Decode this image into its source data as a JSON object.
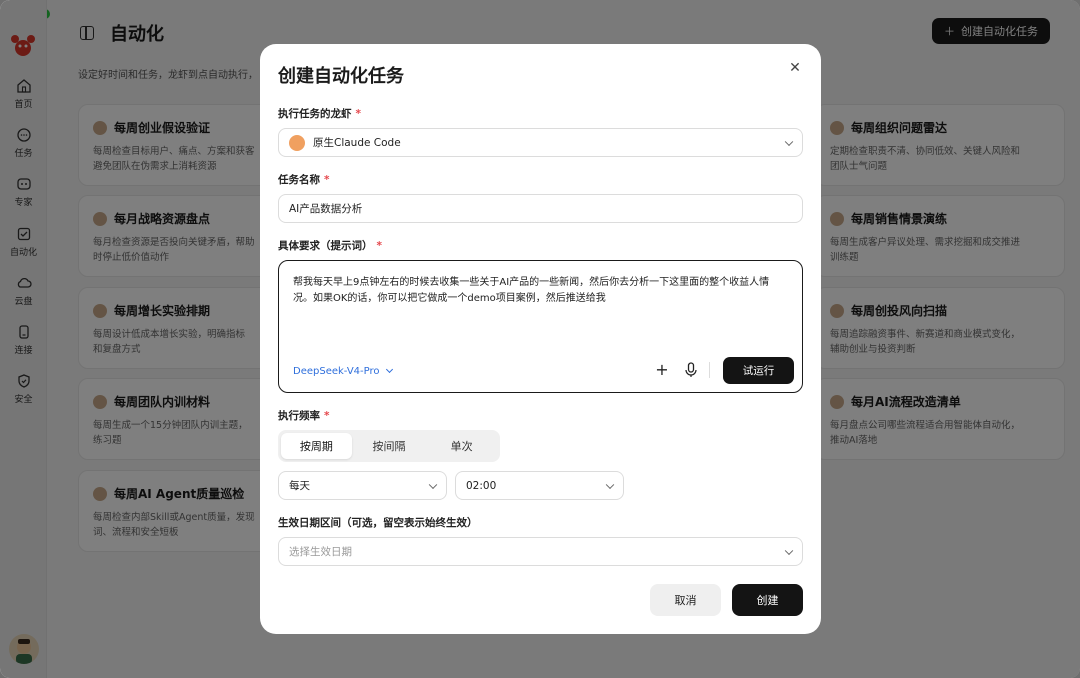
{
  "app": {
    "page_title": "自动化",
    "subtitle": "设定好时间和任务，龙虾到点自动执行，",
    "create_button": "创建自动化任务"
  },
  "sidebar": {
    "items": [
      {
        "label": "首页",
        "icon": "home-icon"
      },
      {
        "label": "任务",
        "icon": "chat-icon"
      },
      {
        "label": "专家",
        "icon": "expert-icon"
      },
      {
        "label": "自动化",
        "icon": "checklist-icon",
        "active": true
      },
      {
        "label": "云盘",
        "icon": "cloud-icon"
      },
      {
        "label": "连接",
        "icon": "device-icon"
      },
      {
        "label": "安全",
        "icon": "shield-icon"
      }
    ]
  },
  "cards_left": [
    {
      "title": "每周创业假设验证",
      "desc": "每周检查目标用户、痛点、方案和获客\n避免团队在伪需求上消耗资源"
    },
    {
      "title": "每月战略资源盘点",
      "desc": "每月检查资源是否投向关键矛盾，帮助\n时停止低价值动作"
    },
    {
      "title": "每周增长实验排期",
      "desc": "每周设计低成本增长实验，明确指标\n和复盘方式"
    },
    {
      "title": "每周团队内训材料",
      "desc": "每周生成一个15分钟团队内训主题，\n练习题"
    },
    {
      "title": "每周AI Agent质量巡检",
      "desc": "每周检查内部Skill或Agent质量，发现\n词、流程和安全短板"
    }
  ],
  "cards_right": [
    {
      "title": "每周组织问题雷达",
      "desc": "定期检查职责不清、协同低效、关键人风险和\n团队士气问题"
    },
    {
      "title": "每周销售情景演练",
      "desc": "每周生成客户异议处理、需求挖掘和成交推进\n训练题"
    },
    {
      "title": "每周创投风向扫描",
      "desc": "每周追踪融资事件、新赛道和商业模式变化，\n辅助创业与投资判断"
    },
    {
      "title": "每月AI流程改造清单",
      "desc": "每月盘点公司哪些流程适合用智能体自动化，\n推动AI落地"
    }
  ],
  "modal": {
    "title": "创建自动化任务",
    "agent_label": "执行任务的龙虾",
    "agent_value": "原生Claude Code",
    "name_label": "任务名称",
    "name_value": "AI产品数据分析",
    "prompt_label": "具体要求（提示词）",
    "prompt_value": "帮我每天早上9点钟左右的时候去收集一些关于AI产品的一些新闻，然后你去分析一下这里面的整个收益人情况。如果OK的话，你可以把它做成一个demo项目案例，然后推送给我",
    "model": "DeepSeek-V4-Pro",
    "try_button": "试运行",
    "frequency_label": "执行频率",
    "frequency_tabs": [
      "按周期",
      "按间隔",
      "单次"
    ],
    "period_value": "每天",
    "time_value": "02:00",
    "date_label": "生效日期区间（可选，留空表示始终生效）",
    "date_placeholder": "选择生效日期",
    "cancel_button": "取消",
    "create_button": "创建",
    "required_mark": "*"
  }
}
